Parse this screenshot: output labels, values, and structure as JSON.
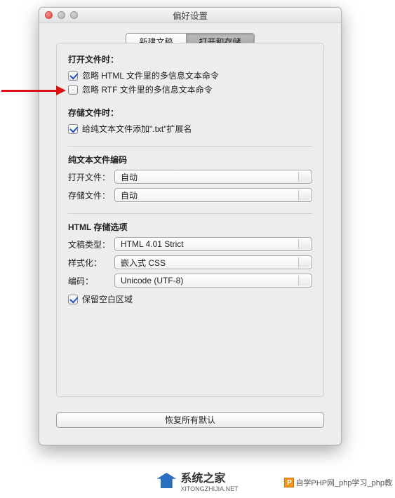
{
  "window": {
    "title": "偏好设置"
  },
  "tabs": {
    "new_doc": "新建文稿",
    "open_save": "打开和存储"
  },
  "open_section": {
    "title": "打开文件时：",
    "ignore_html": "忽略 HTML 文件里的多信息文本命令",
    "ignore_rtf": "忽略 RTF 文件里的多信息文本命令"
  },
  "save_section": {
    "title": "存储文件时：",
    "add_txt_ext": "给纯文本文件添加\".txt\"扩展名"
  },
  "encoding_section": {
    "title": "纯文本文件编码",
    "open_label": "打开文件：",
    "open_value": "自动",
    "save_label": "存储文件：",
    "save_value": "自动"
  },
  "html_section": {
    "title": "HTML 存储选项",
    "doctype_label": "文稿类型：",
    "doctype_value": "HTML 4.01 Strict",
    "style_label": "样式化：",
    "style_value": "嵌入式 CSS",
    "encoding_label": "编码：",
    "encoding_value": "Unicode (UTF-8)",
    "preserve_whitespace": "保留空白区域"
  },
  "restore_defaults": "恢复所有默认",
  "footer": {
    "brand": "系统之家",
    "domain": "XITONGZHIJIA.NET",
    "pagelink": "自学PHP网_php学习_php教"
  }
}
